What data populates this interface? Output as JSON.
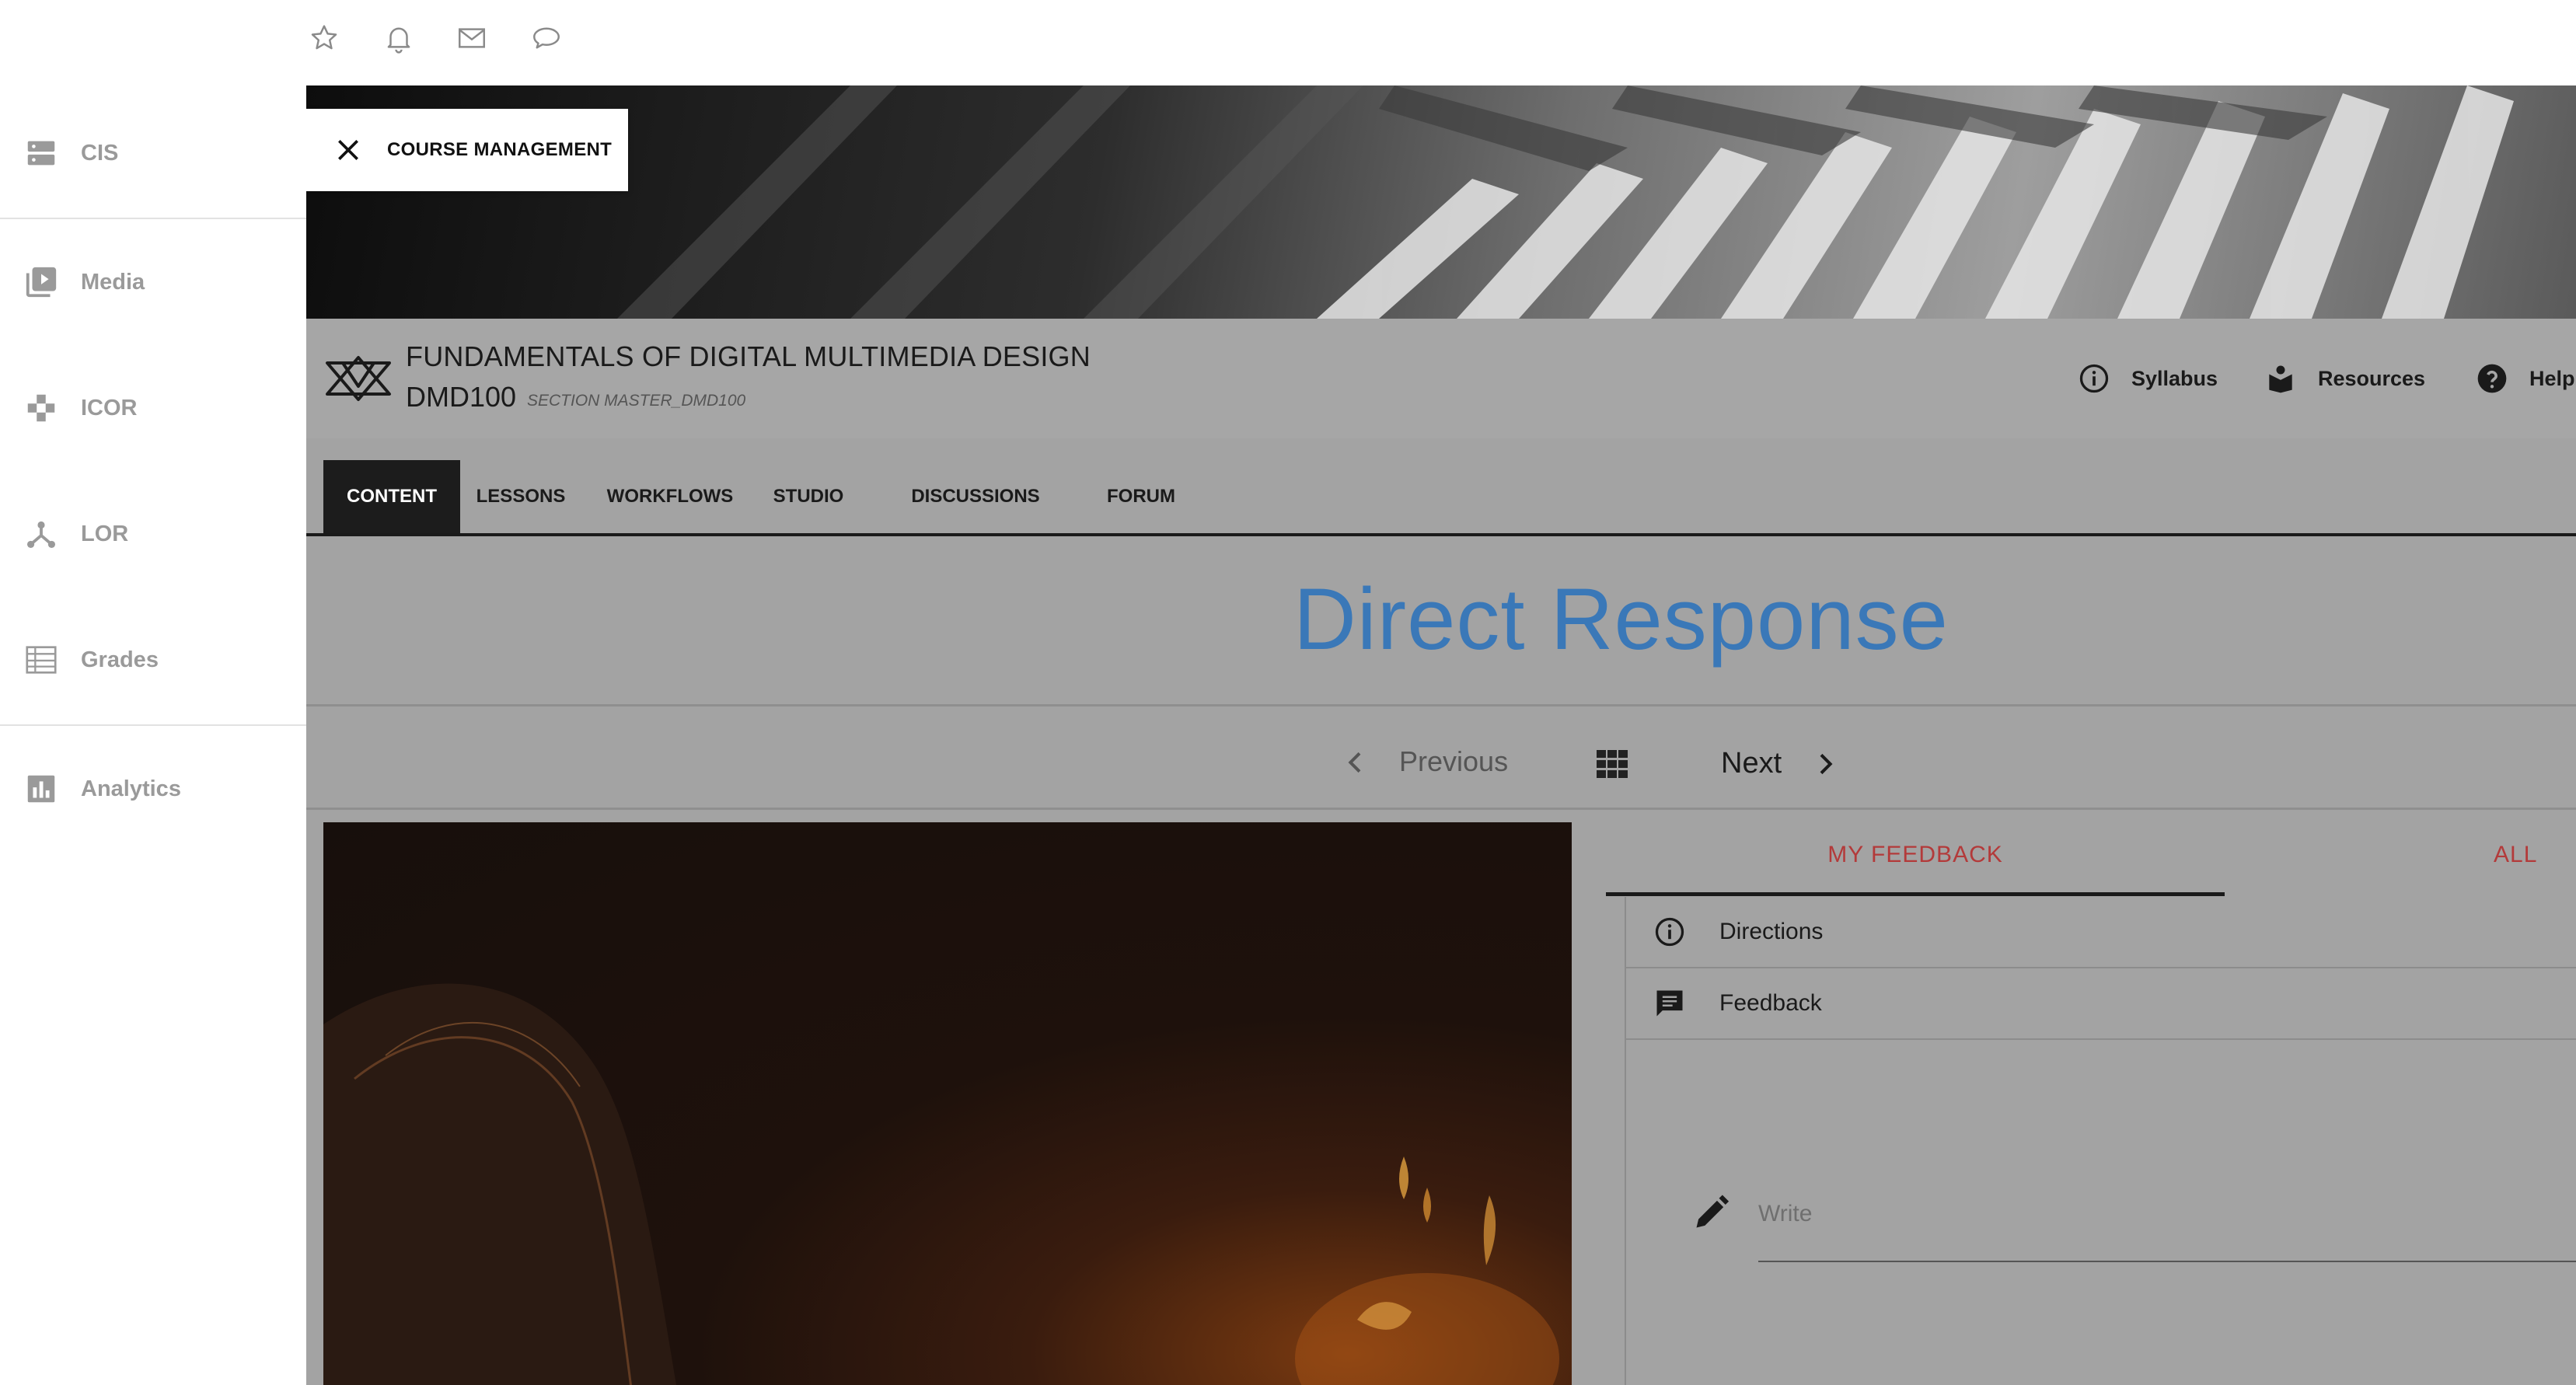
{
  "topbar": {
    "icons": [
      "star-icon",
      "bell-icon",
      "mail-icon",
      "chat-bubble-icon"
    ]
  },
  "sidebar": {
    "items": [
      {
        "label": "CIS",
        "icon": "server-icon"
      },
      {
        "label": "Media",
        "icon": "video-library-icon"
      },
      {
        "label": "ICOR",
        "icon": "puzzle-icon"
      },
      {
        "label": "LOR",
        "icon": "network-icon"
      },
      {
        "label": "Grades",
        "icon": "table-icon"
      },
      {
        "label": "Analytics",
        "icon": "bar-chart-icon"
      }
    ]
  },
  "header": {
    "course_management": "COURSE MANAGEMENT",
    "course_title": "FUNDAMENTALS OF DIGITAL MULTIMEDIA DESIGN",
    "course_code": "DMD100",
    "section": "SECTION MASTER_DMD100",
    "links": [
      {
        "label": "Syllabus",
        "icon": "info-icon"
      },
      {
        "label": "Resources",
        "icon": "book-icon"
      },
      {
        "label": "Help",
        "icon": "help-icon"
      }
    ]
  },
  "tabs": [
    {
      "label": "CONTENT",
      "active": true
    },
    {
      "label": "LESSONS",
      "active": false
    },
    {
      "label": "WORKFLOWS",
      "active": false
    },
    {
      "label": "STUDIO",
      "active": false
    },
    {
      "label": "DISCUSSIONS",
      "active": false
    },
    {
      "label": "FORUM",
      "active": false
    }
  ],
  "page": {
    "title": "Direct Response",
    "nav": {
      "previous": "Previous",
      "next": "Next"
    }
  },
  "feedback": {
    "tabs": [
      "MY FEEDBACK",
      "ALL"
    ],
    "rows": [
      {
        "label": "Directions",
        "icon": "info-icon"
      },
      {
        "label": "Feedback",
        "icon": "comment-icon"
      }
    ],
    "write_placeholder": "Write"
  },
  "colors": {
    "title_blue": "#3a78b8",
    "tab_red": "#b33a3a",
    "overlay_gray": "#a3a3a3",
    "active_tab": "#1c1c1c"
  }
}
